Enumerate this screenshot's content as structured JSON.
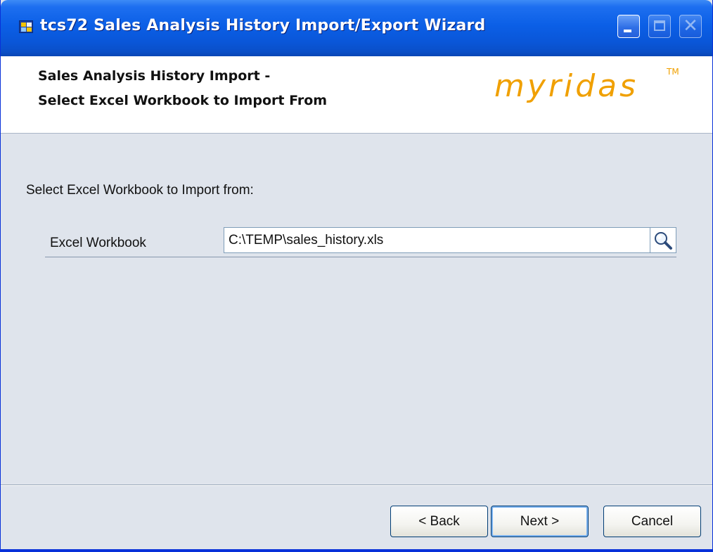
{
  "window": {
    "title": "tcs72 Sales Analysis History Import/Export Wizard",
    "icon": "spreadsheet-icon",
    "controls": {
      "minimize": "minimize-icon",
      "maximize": "maximize-icon",
      "close": "close-icon",
      "close_glyph": "✕"
    }
  },
  "header": {
    "title_line1": "Sales Analysis History Import -",
    "title_line2": "Select Excel Workbook to Import From",
    "logo_text": "myridas",
    "logo_tm": "TM",
    "logo_color": "#f0a000"
  },
  "main": {
    "prompt": "Select Excel Workbook to Import from:",
    "field": {
      "label": "Excel Workbook",
      "value": "C:\\TEMP\\sales_history.xls",
      "browse_icon": "magnifier-icon"
    }
  },
  "footer": {
    "back_label": "< Back",
    "next_label": "Next >",
    "cancel_label": "Cancel"
  },
  "colors": {
    "titlebar": "#0b5fe6",
    "body_background": "#dfe4ec",
    "header_background": "#ffffff"
  }
}
